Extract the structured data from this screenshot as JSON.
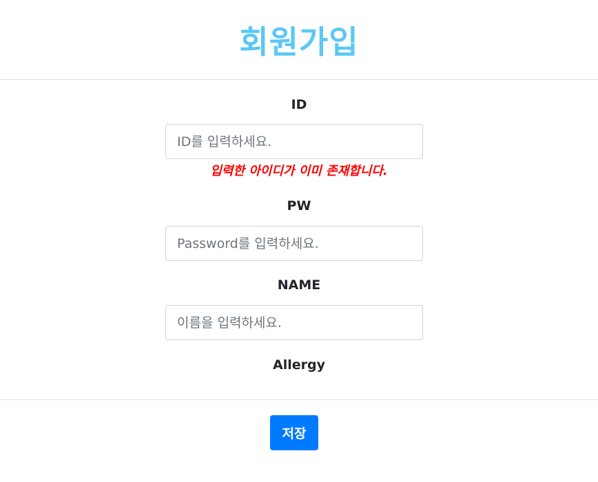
{
  "header": {
    "title": "회원가입"
  },
  "form": {
    "id": {
      "label": "ID",
      "placeholder": "ID를 입력하세요.",
      "value": "",
      "error": "입력한 아이디가 이미 존재합니다."
    },
    "pw": {
      "label": "PW",
      "placeholder": "Password를 입력하세요.",
      "value": ""
    },
    "name": {
      "label": "NAME",
      "placeholder": "이름을 입력하세요.",
      "value": ""
    },
    "allergy": {
      "label": "Allergy"
    }
  },
  "footer": {
    "save_label": "저장"
  },
  "colors": {
    "title": "#5bc8f5",
    "error": "#ff0000",
    "primary_button": "#007bff"
  }
}
